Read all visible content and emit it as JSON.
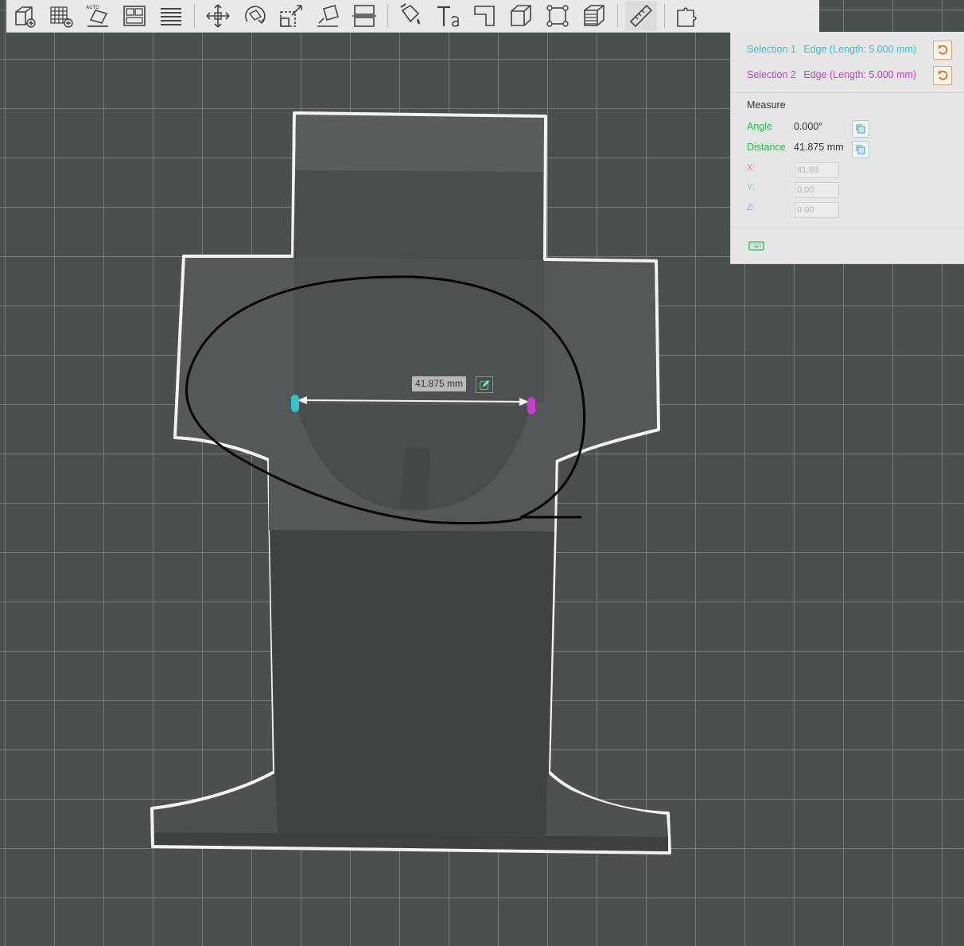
{
  "toolbar": {
    "tools": [
      {
        "name": "add-object-icon"
      },
      {
        "name": "add-plate-icon"
      },
      {
        "name": "auto-orient-icon",
        "label": "AUTO"
      },
      {
        "name": "arrange-icon"
      },
      {
        "name": "split-list-icon"
      },
      {
        "name": "move-icon"
      },
      {
        "name": "rotate-icon"
      },
      {
        "name": "scale-icon"
      },
      {
        "name": "lay-on-face-icon"
      },
      {
        "name": "cut-icon"
      },
      {
        "name": "paint-support-icon"
      },
      {
        "name": "text-icon"
      },
      {
        "name": "variable-layer-icon"
      },
      {
        "name": "cube-icon"
      },
      {
        "name": "boolean-icon"
      },
      {
        "name": "mesh-fill-icon"
      },
      {
        "name": "measure-ruler-icon"
      },
      {
        "name": "assembly-icon"
      }
    ]
  },
  "measure_panel": {
    "selection1_label": "Selection 1",
    "selection1_value": "Edge (Length: 5.000 mm)",
    "selection2_label": "Selection 2",
    "selection2_value": "Edge (Length: 5.000 mm)",
    "section_title": "Measure",
    "angle_label": "Angle",
    "angle_value": "0.000°",
    "distance_label": "Distance",
    "distance_value": "41.875 mm",
    "x_label": "X:",
    "x_value": "41.88",
    "y_label": "Y:",
    "y_value": "0.00",
    "z_label": "Z:",
    "z_value": "0.00",
    "keyboard_icon": "keyboard-icon"
  },
  "viewport": {
    "dimension_label": "41.875 mm"
  },
  "colors": {
    "selection1": "#34c3c7",
    "selection2": "#c83cd0",
    "measure_green": "#1fbf4b",
    "reset_orange": "#e46a1e",
    "x_axis": "#f08080",
    "y_axis": "#7fd97f",
    "z_axis": "#8aa0ef"
  }
}
